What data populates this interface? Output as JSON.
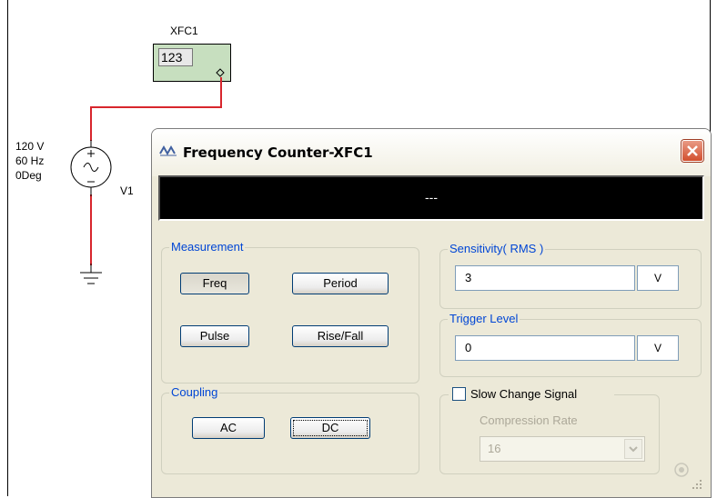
{
  "schematic": {
    "instrument_label": "XFC1",
    "instrument_display": "123",
    "source_voltage": "120 V",
    "source_frequency": "60 Hz",
    "source_phase": "0Deg",
    "source_label": "V1"
  },
  "dialog": {
    "title": "Frequency Counter-XFC1",
    "display_value": "---",
    "measurement": {
      "label": "Measurement",
      "buttons": [
        "Freq",
        "Period",
        "Pulse",
        "Rise/Fall"
      ],
      "selected": "Freq"
    },
    "coupling": {
      "label": "Coupling",
      "buttons": [
        "AC",
        "DC"
      ],
      "focused": "DC"
    },
    "sensitivity": {
      "label": "Sensitivity( RMS )",
      "value": "3",
      "unit": "V"
    },
    "trigger": {
      "label": "Trigger Level",
      "value": "0",
      "unit": "V"
    },
    "slow_change": {
      "label": "Slow Change Signal",
      "checked": false,
      "compression_label": "Compression Rate",
      "compression_value": "16"
    }
  },
  "colors": {
    "wire": "#d8262d",
    "instrument_body": "#c7dfbf",
    "group_label": "#0046d5"
  }
}
